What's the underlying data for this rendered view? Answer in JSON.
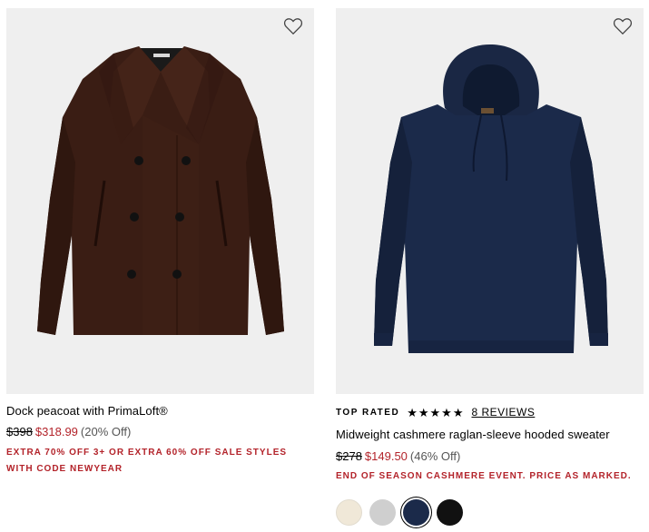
{
  "products": [
    {
      "name": "Dock peacoat with PrimaLoft®",
      "price_original": "$398",
      "price_sale": "$318.99",
      "discount": "(20% Off)",
      "promo": "EXTRA 70% OFF 3+ OR EXTRA 60% OFF SALE STYLES WITH CODE NEWYEAR",
      "image_icon": "brown-peacoat-image",
      "wishlist_icon": "heart-outline-icon"
    },
    {
      "badge": "TOP RATED",
      "rating": 5,
      "stars": "★★★★★",
      "reviews": "8 REVIEWS",
      "name": "Midweight cashmere raglan-sleeve hooded sweater",
      "price_original": "$278",
      "price_sale": "$149.50",
      "discount": "(46% Off)",
      "promo": "END OF SEASON CASHMERE EVENT. PRICE AS MARKED.",
      "image_icon": "navy-hoodie-image",
      "wishlist_icon": "heart-outline-icon",
      "swatches": [
        {
          "name": "ivory",
          "color": "#f0e8d8"
        },
        {
          "name": "heather-grey",
          "color": "#cfcfcf"
        },
        {
          "name": "navy",
          "color": "#1b2a4a"
        },
        {
          "name": "black",
          "color": "#111111"
        }
      ],
      "selected_swatch": "navy"
    }
  ],
  "colors": {
    "sale": "#b3232a",
    "image_bg": "#efefef",
    "coat": "#3a1d14",
    "hoodie": "#1b2a4a"
  }
}
